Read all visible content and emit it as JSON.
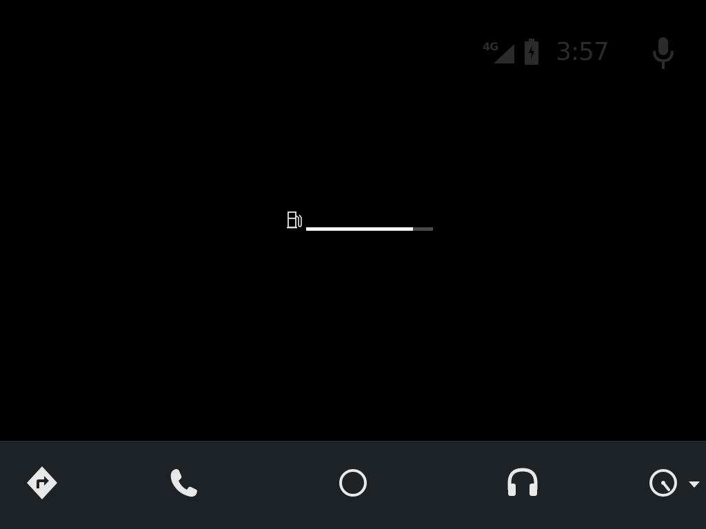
{
  "status_bar": {
    "network_type": "4G",
    "time": "3:57",
    "icons": [
      "signal-icon",
      "battery-charging-icon",
      "mic-icon"
    ]
  },
  "fuel": {
    "icon": "fuel-pump-icon",
    "level_fraction": 0.84
  },
  "nav": {
    "items": [
      {
        "name": "navigation",
        "icon": "directions-icon"
      },
      {
        "name": "phone",
        "icon": "phone-icon"
      },
      {
        "name": "home",
        "icon": "home-circle-icon"
      },
      {
        "name": "media",
        "icon": "headphones-icon"
      },
      {
        "name": "overview",
        "icon": "gauge-icon"
      }
    ]
  },
  "colors": {
    "background": "#000000",
    "nav_background": "#1d2226",
    "icon_light": "#e8e8e8",
    "status_dim": "#2b2b2b",
    "fuel_fill": "#ffffff",
    "fuel_track": "#4a4a4a"
  }
}
